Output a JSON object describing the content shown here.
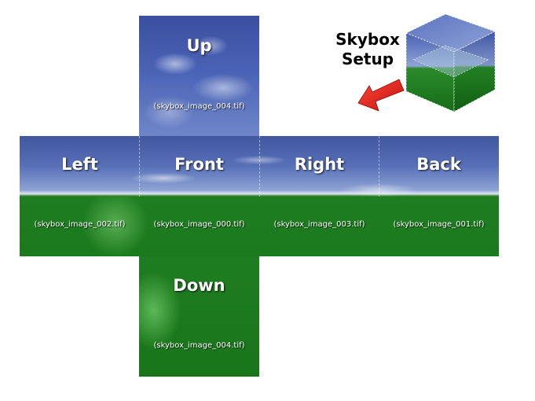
{
  "title": {
    "line1": "Skybox",
    "line2": "Setup"
  },
  "faces": {
    "up": {
      "label": "Up",
      "file": "(skybox_image_004.tif)"
    },
    "left": {
      "label": "Left",
      "file": "(skybox_image_002.tif)"
    },
    "front": {
      "label": "Front",
      "file": "(skybox_image_000.tif)"
    },
    "right": {
      "label": "Right",
      "file": "(skybox_image_003.tif)"
    },
    "back": {
      "label": "Back",
      "file": "(skybox_image_001.tif)"
    },
    "down": {
      "label": "Down",
      "file": "(skybox_image_004.tif)"
    }
  },
  "colors": {
    "sky": "#4a62b5",
    "grass": "#1b7a1d",
    "arrow": "#e8201c",
    "text": "#ffffff",
    "title_text": "#000000"
  },
  "icons": {
    "arrow": "red-arrow-icon",
    "cube": "skybox-cube-icon"
  }
}
